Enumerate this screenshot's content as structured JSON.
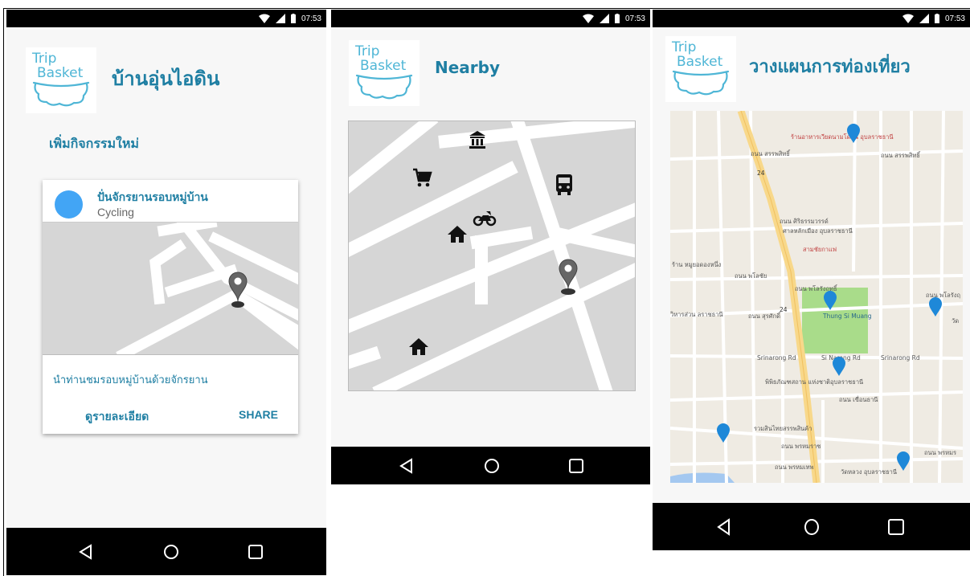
{
  "status": {
    "time": "07:53"
  },
  "screen1": {
    "title": "บ้านอุ่นไอดิน",
    "add_activity": "เพิ่มกิจกรรมใหม่",
    "card": {
      "activity_name": "ปั่นจักรยานรอบหมู่บ้าน",
      "activity_type": "Cycling",
      "description": "นำท่านชมรอบหมู่บ้านด้วยจักรยาน",
      "details_button": "ดูรายละเอียด",
      "share_button": "SHARE"
    }
  },
  "screen2": {
    "title": "Nearby"
  },
  "screen3": {
    "title": "วางแผนการท่องเที่ยว",
    "map_labels": {
      "restaurant": "ร้านอาหารเวียดนามโดจิน อุบลราชธานี",
      "road_sanphasit_1": "ถนน สรรพสิทธิ์",
      "road_sanphasit_2": "ถนน สรรพสิทธิ์",
      "road_siritarawat": "ถนน ศิริธรรมวรรด์",
      "shrine": "ศาลหลักเมือง อุบลราชธานี",
      "cafe": "สามชัยกาแฟ",
      "shop": "ร้าน หมูยอดองหนึ่ง",
      "road_phalochai": "ถนน พโลชัย",
      "road_phalorangrit": "ถนน พโลรังฤทธิ์",
      "road_phalorangrit_2": "ถนน พโลรังฤ",
      "road_ubonrat": "ถนน สุรศักดิ์",
      "route_24a": "24",
      "route_24b": "24",
      "park": "Thung Si Muang",
      "srinarong_1": "Srinarong Rd",
      "srinarong_2": "Si Narong Rd",
      "srinarong_3": "Srinarong Rd",
      "museum": "พิพิธภัณฑสถาน แห่งชาติอุบลราชธานี",
      "road_khuenthani": "ถนน เขื่อนธานี",
      "store": "รวมสินไทยสรรพสินค้า",
      "road_phromrat": "ถนน พรหมราช",
      "road_phromthep": "ถนน พรหมเทพ",
      "temple": "วัดหลวง อุบลราชธานี",
      "wihan": "วิหารส่วน ลราชธานี",
      "wat_right": "วัด",
      "road_phromrat_right": "ถนน พรหมร"
    }
  },
  "colors": {
    "title": "#1f7fa3",
    "accent": "#4fb6d6",
    "avatar": "#42a5f5",
    "map_pin": "#1e88d8",
    "park": "#a9dc8a"
  },
  "icons": [
    "wifi-icon",
    "signal-icon",
    "battery-icon",
    "back-icon",
    "home-icon",
    "recents-icon",
    "location-pin-icon",
    "bank-icon",
    "cart-icon",
    "bus-icon",
    "motorcycle-icon",
    "house-icon"
  ]
}
